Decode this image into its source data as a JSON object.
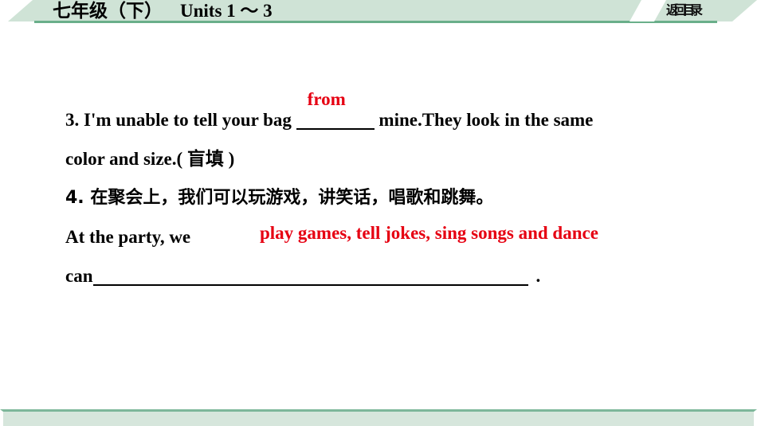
{
  "header": {
    "grade_title": "七年级（下）",
    "units_title": "Units 1 ～ 3",
    "return_button": "返回目录"
  },
  "main": {
    "questions": [
      {
        "number": "3.",
        "line1_before": "3. I'm unable to tell your bag ",
        "blank_answer": "from",
        "line1_after": " mine.They look in the same",
        "line2": "color and size.( 盲填 )"
      },
      {
        "number": "4.",
        "chinese_prompt": "4. 在聚会上，我们可以玩游戏，讲笑话，唱歌和跳舞。",
        "english_start": "At the party, we",
        "answer": "play games, tell jokes, sing songs and dance",
        "line_can": "can",
        "line_period": "."
      }
    ]
  },
  "colors": {
    "answer_red": "#e60012",
    "header_band": "#cfe3d6",
    "header_rule": "#6aaf8a",
    "footer_band": "#d6e6dc",
    "footer_rule": "#7db79a"
  }
}
